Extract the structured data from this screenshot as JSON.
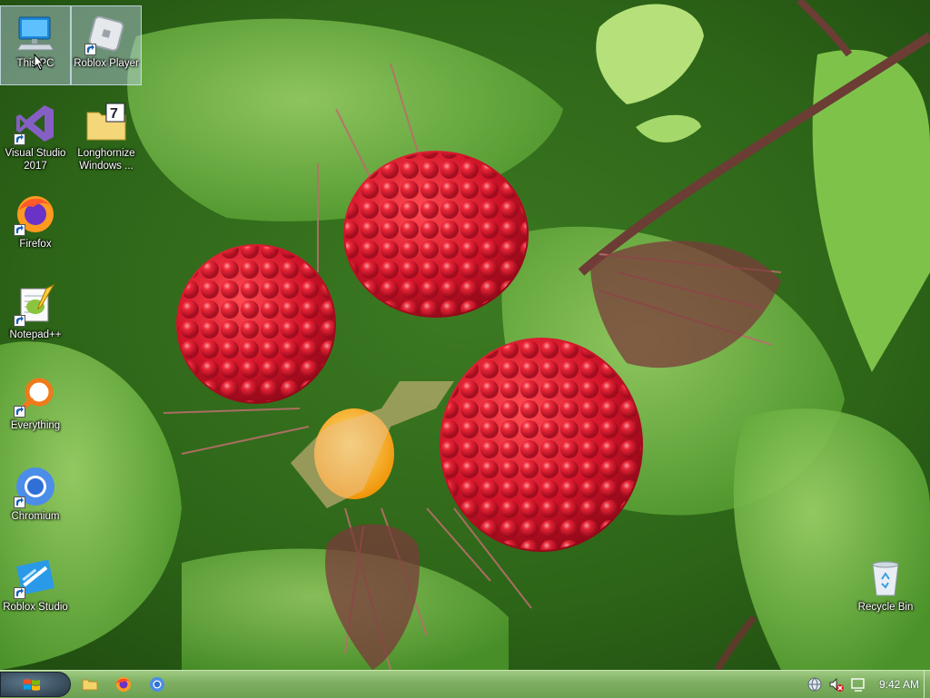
{
  "desktop": {
    "icons": [
      {
        "label": "This PC",
        "icon": "computer-icon",
        "shortcut": false
      },
      {
        "label": "Roblox Player",
        "icon": "roblox-player-icon",
        "shortcut": true
      },
      {
        "label": "Visual Studio 2017",
        "icon": "visual-studio-icon",
        "shortcut": true
      },
      {
        "label": "Longhornize Windows ...",
        "icon": "longhornize-icon",
        "shortcut": false
      },
      {
        "label": "Firefox",
        "icon": "firefox-icon",
        "shortcut": true
      },
      {
        "label": "Notepad++",
        "icon": "notepadpp-icon",
        "shortcut": true
      },
      {
        "label": "Everything",
        "icon": "everything-search-icon",
        "shortcut": true
      },
      {
        "label": "Chromium",
        "icon": "chromium-icon",
        "shortcut": true
      },
      {
        "label": "Roblox Studio",
        "icon": "roblox-studio-icon",
        "shortcut": true
      },
      {
        "label": "Recycle Bin",
        "icon": "recycle-bin-icon",
        "shortcut": false
      }
    ]
  },
  "taskbar": {
    "start_icon": "windows-logo-icon",
    "pinned": [
      {
        "name": "File Explorer",
        "icon": "folder-icon"
      },
      {
        "name": "Firefox",
        "icon": "firefox-icon"
      },
      {
        "name": "Chromium",
        "icon": "chromium-icon"
      }
    ],
    "tray": {
      "icons": [
        "network-globe-icon",
        "volume-muted-icon",
        "action-center-icon"
      ],
      "clock": "9:42 AM"
    }
  },
  "colors": {
    "taskbar_top": "#9fcb82",
    "taskbar_bottom": "#6ea051",
    "selection": "#bed2eb"
  }
}
